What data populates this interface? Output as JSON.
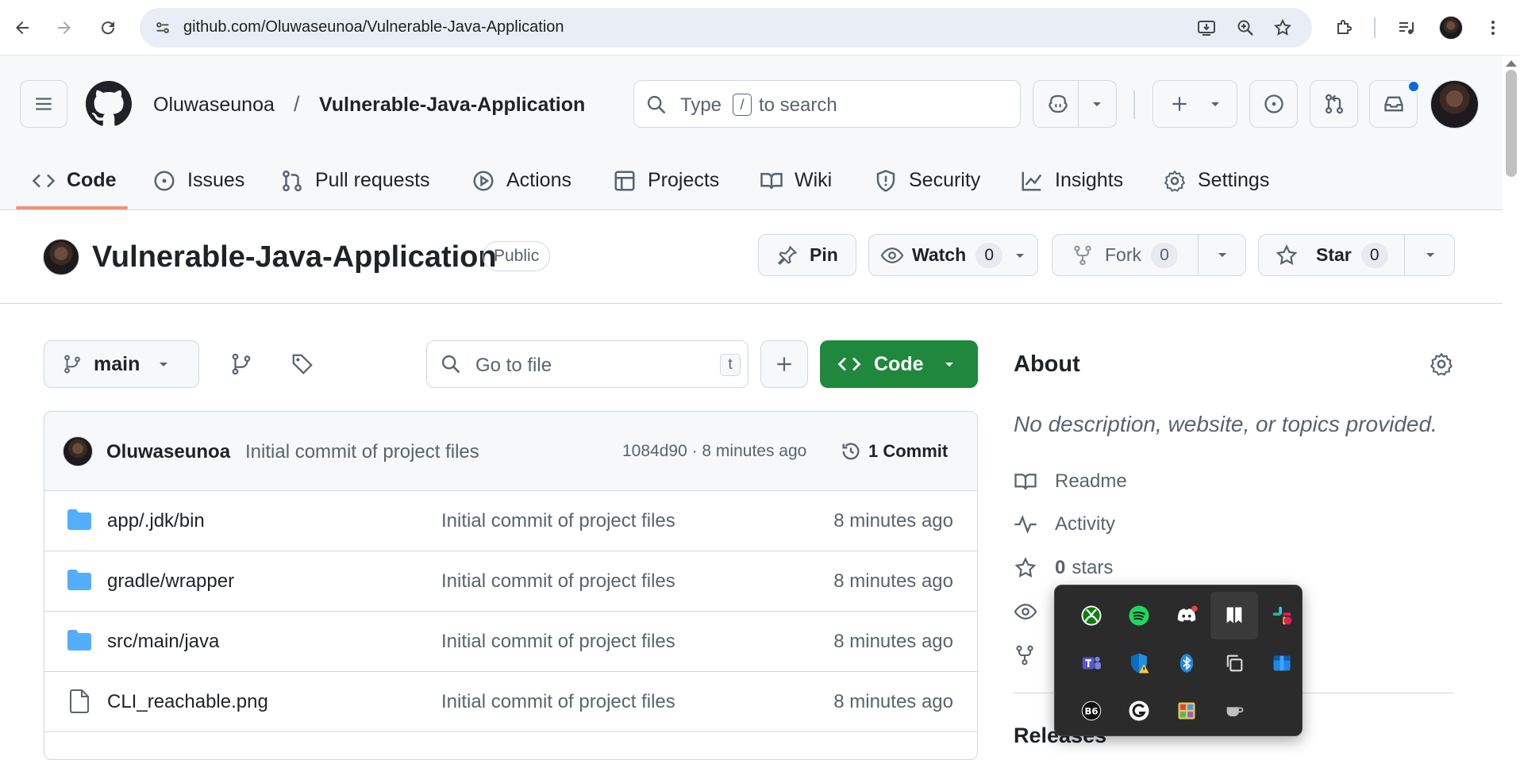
{
  "browser": {
    "url": "github.com/Oluwaseunoa/Vulnerable-Java-Application"
  },
  "header": {
    "owner": "Oluwaseunoa",
    "separator": "/",
    "repo": "Vulnerable-Java-Application",
    "search_type": "Type",
    "search_key": "/",
    "search_rest": "to search"
  },
  "tabs": [
    {
      "label": "Code",
      "icon": "code-icon",
      "active": true
    },
    {
      "label": "Issues",
      "icon": "issue-icon"
    },
    {
      "label": "Pull requests",
      "icon": "pull-request-icon"
    },
    {
      "label": "Actions",
      "icon": "play-icon"
    },
    {
      "label": "Projects",
      "icon": "table-icon"
    },
    {
      "label": "Wiki",
      "icon": "book-icon"
    },
    {
      "label": "Security",
      "icon": "shield-icon"
    },
    {
      "label": "Insights",
      "icon": "graph-icon"
    },
    {
      "label": "Settings",
      "icon": "gear-icon"
    }
  ],
  "repo": {
    "title": "Vulnerable-Java-Application",
    "visibility": "Public",
    "pin_label": "Pin",
    "watch_label": "Watch",
    "watch_count": "0",
    "fork_label": "Fork",
    "fork_count": "0",
    "star_label": "Star",
    "star_count": "0"
  },
  "controls": {
    "branch": "main",
    "goto_placeholder": "Go to file",
    "goto_key": "t",
    "code_label": "Code"
  },
  "commit": {
    "author": "Oluwaseunoa",
    "message": "Initial commit of project files",
    "hash_time": "1084d90 · 8 minutes ago",
    "count_label": "1 Commit"
  },
  "files": [
    {
      "name": "app/.jdk/bin",
      "type": "folder",
      "message": "Initial commit of project files",
      "age": "8 minutes ago"
    },
    {
      "name": "gradle/wrapper",
      "type": "folder",
      "message": "Initial commit of project files",
      "age": "8 minutes ago"
    },
    {
      "name": "src/main/java",
      "type": "folder",
      "message": "Initial commit of project files",
      "age": "8 minutes ago"
    },
    {
      "name": "CLI_reachable.png",
      "type": "file",
      "message": "Initial commit of project files",
      "age": "8 minutes ago"
    }
  ],
  "about": {
    "heading": "About",
    "description": "No description, website, or topics provided.",
    "readme": "Readme",
    "activity": "Activity",
    "stars_count": "0",
    "stars_label": "stars",
    "releases": "Releases"
  },
  "tray": {
    "icons": [
      "xbox-icon",
      "spotify-icon",
      "discord-icon",
      "bookmark-app-icon",
      "slack-icon",
      "teams-icon",
      "defender-warning-icon",
      "bluetooth-icon",
      "copy-app-icon",
      "blue-app-icon",
      "bandcamp-icon",
      "grammarly-icon",
      "paint-icon",
      "cup-icon"
    ]
  },
  "colors": {
    "accent_green": "#1f883d",
    "tab_underline": "#fd8c73",
    "folder_blue": "#54aeff",
    "notification_blue": "#0969da"
  }
}
